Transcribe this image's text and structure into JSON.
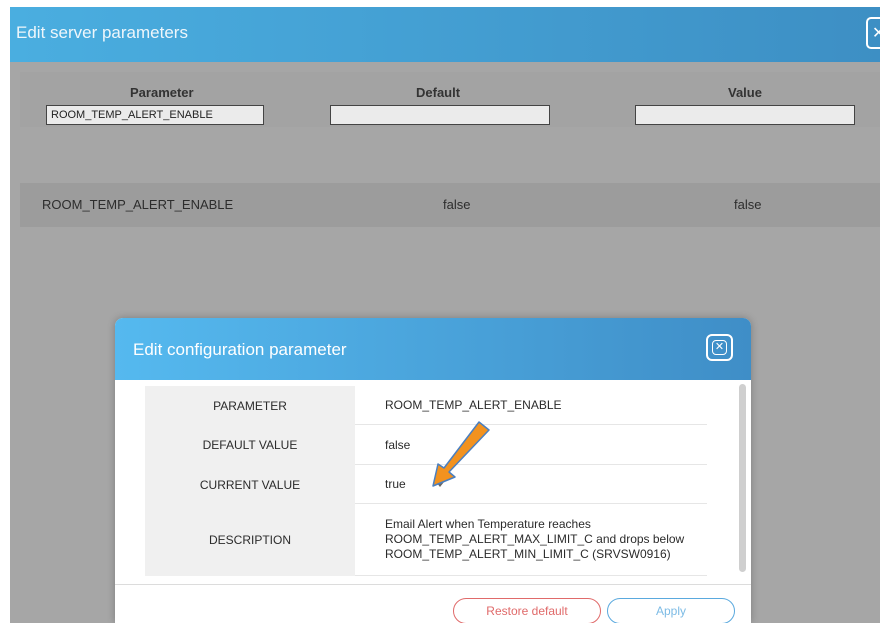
{
  "server_window": {
    "title": "Edit server parameters",
    "columns": {
      "parameter": "Parameter",
      "default": "Default",
      "value": "Value"
    },
    "filters": {
      "parameter": "ROOM_TEMP_ALERT_ENABLE",
      "default": "",
      "value": ""
    },
    "rows": [
      {
        "parameter": "ROOM_TEMP_ALERT_ENABLE",
        "default": "false",
        "value": "false"
      }
    ]
  },
  "modal": {
    "title": "Edit configuration parameter",
    "fields": {
      "parameter_label": "PARAMETER",
      "parameter_value": "ROOM_TEMP_ALERT_ENABLE",
      "default_label": "DEFAULT VALUE",
      "default_value": "false",
      "current_label": "CURRENT VALUE",
      "current_value": "true",
      "description_label": "DESCRIPTION",
      "description_line1": "Email Alert when Temperature reaches",
      "description_line2": "ROOM_TEMP_ALERT_MAX_LIMIT_C and drops below",
      "description_line3": "ROOM_TEMP_ALERT_MIN_LIMIT_C (SRVSW0916)"
    },
    "buttons": {
      "restore": "Restore default",
      "apply": "Apply"
    }
  },
  "icons": {
    "close": "close-icon",
    "dropdown": "chevron-down-icon",
    "annotation": "orange-arrow"
  },
  "colors": {
    "header_blue": "#4aaee0",
    "restore_red": "#e06a6a",
    "apply_blue": "#5aa9de",
    "annotation_orange": "#f2921f"
  }
}
